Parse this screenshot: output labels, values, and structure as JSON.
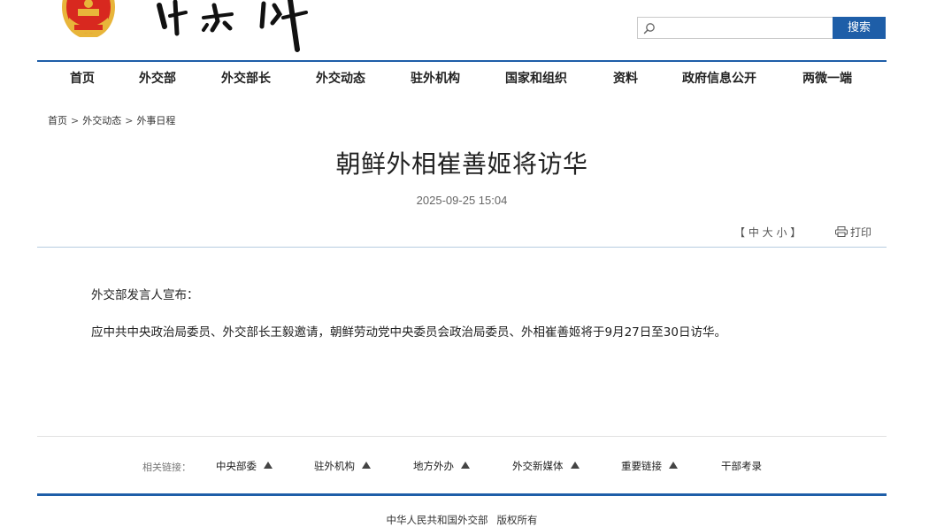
{
  "header": {
    "search": {
      "placeholder": "",
      "button_label": "搜索"
    }
  },
  "nav": {
    "items": [
      "首页",
      "外交部",
      "外交部长",
      "外交动态",
      "驻外机构",
      "国家和组织",
      "资料",
      "政府信息公开",
      "两微一端"
    ]
  },
  "breadcrumb": [
    "首页",
    "外交动态",
    "外事日程"
  ],
  "breadcrumb_sep": ">",
  "article": {
    "title": "朝鲜外相崔善姬将访华",
    "date": "2025-09-25 15:04",
    "font_control": "【 中  大  小 】",
    "print_label": "打印",
    "paragraphs": [
      "外交部发言人宣布：",
      "应中共中央政治局委员、外交部长王毅邀请，朝鲜劳动党中央委员会政治局委员、外相崔善姬将于9月27日至30日访华。"
    ]
  },
  "related": {
    "label": "相关链接：",
    "items": [
      "中央部委",
      "驻外机构",
      "地方外办",
      "外交新媒体",
      "重要链接",
      "干部考录"
    ]
  },
  "footer": {
    "org": "中华人民共和国外交部",
    "rights": "版权所有"
  },
  "colors": {
    "brand_blue": "#1e5ea8",
    "emblem_red": "#d8281f",
    "emblem_gold": "#e8b53a"
  }
}
